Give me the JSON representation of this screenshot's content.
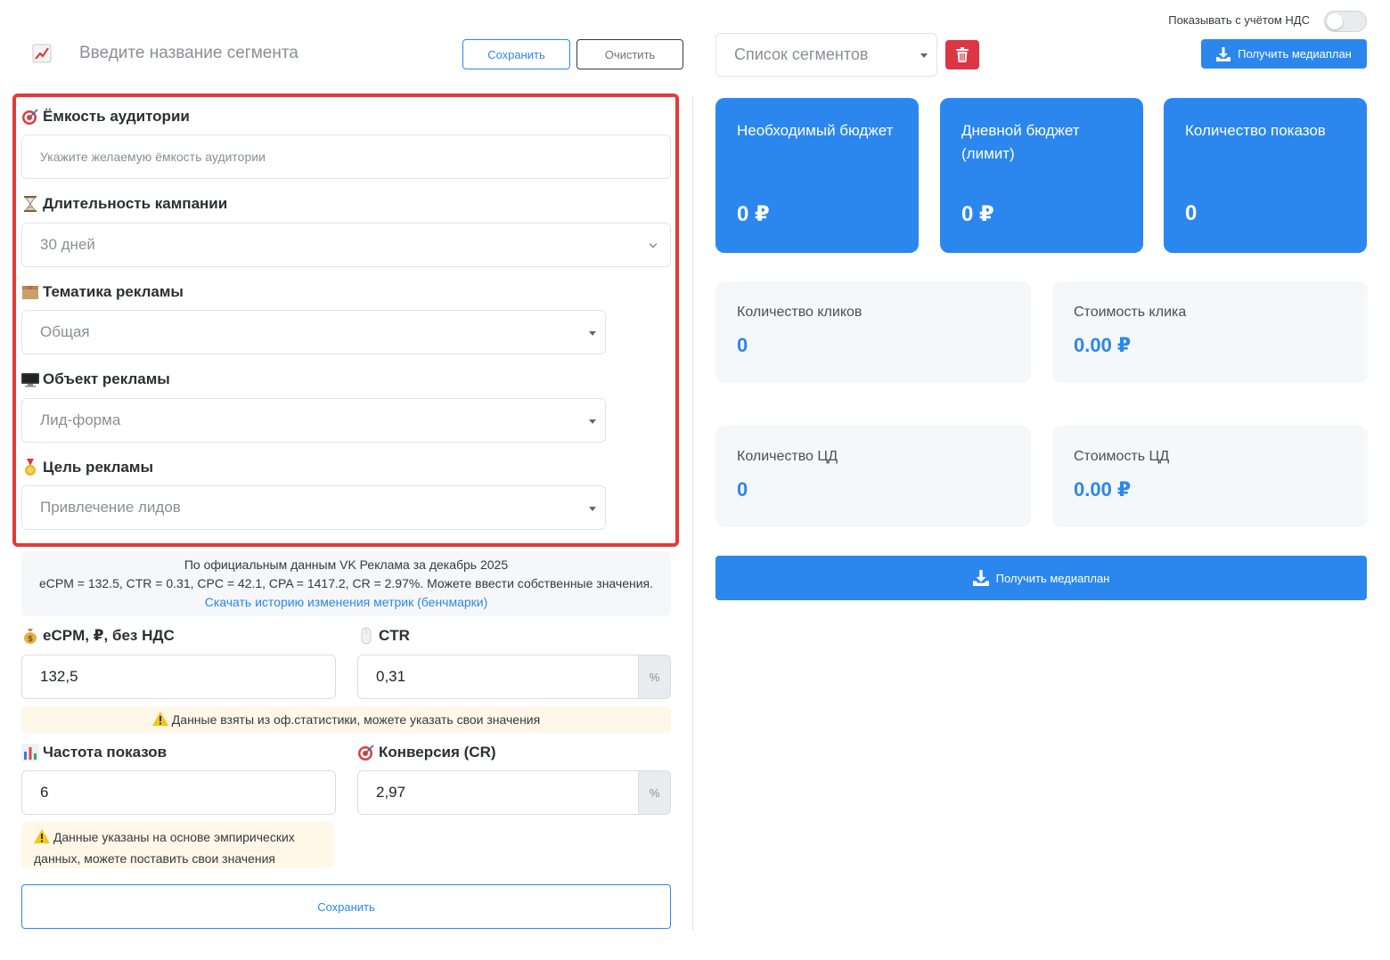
{
  "header": {
    "segment_name_placeholder": "Введите название сегмента",
    "save_label": "Сохранить",
    "clear_label": "Очистить",
    "vat_toggle_label": "Показывать с учётом НДС",
    "vat_toggle_on": false,
    "segments_select_placeholder": "Список сегментов",
    "mediaplan_label": "Получить медиаплан"
  },
  "form": {
    "audience": {
      "label": "Ёмкость аудитории",
      "placeholder": "Укажите желаемую ёмкость аудитории",
      "icon": "target-icon"
    },
    "duration": {
      "label": "Длительность кампании",
      "value": "30 дней",
      "icon": "hourglass-icon"
    },
    "topic": {
      "label": "Тематика рекламы",
      "value": "Общая",
      "icon": "box-icon"
    },
    "object": {
      "label": "Объект рекламы",
      "value": "Лид-форма",
      "icon": "monitor-icon"
    },
    "goal": {
      "label": "Цель рекламы",
      "value": "Привлечение лидов",
      "icon": "medal-icon"
    },
    "info": {
      "line1": "По официальным данным VK Реклама за декабрь 2025",
      "line2": "eCPM = 132.5, CTR = 0.31, CPC = 42.1, CPA = 1417.2, CR = 2.97%. Можете ввести собственные значения.",
      "link": "Скачать историю изменения метрик (бенчмарки)"
    },
    "ecpm": {
      "label": "eCPM, ₽, без НДС",
      "value": "132,5",
      "icon": "money-bag-icon"
    },
    "ctr": {
      "label": "CTR",
      "value": "0,31",
      "addon": "%",
      "icon": "mouse-icon"
    },
    "stats_warning": "Данные взяты из оф.статистики, можете указать свои значения",
    "frequency": {
      "label": "Частота показов",
      "value": "6",
      "icon": "bar-chart-icon"
    },
    "cr": {
      "label": "Конверсия (CR)",
      "value": "2,97",
      "addon": "%",
      "icon": "target-icon"
    },
    "empirical_warning": "Данные указаны на основе эмпирических данных, можете поставить свои значения",
    "save_label": "Сохранить"
  },
  "metrics": {
    "budget": {
      "label": "Необходимый бюджет",
      "value": "0 ₽"
    },
    "daily_budget": {
      "label": "Дневной бюджет (лимит)",
      "value": "0 ₽"
    },
    "impressions": {
      "label": "Количество показов",
      "value": "0"
    },
    "clicks": {
      "label": "Количество кликов",
      "value": "0"
    },
    "click_cost": {
      "label": "Стоимость клика",
      "value": "0.00 ₽"
    },
    "conversions": {
      "label": "Количество ЦД",
      "value": "0"
    },
    "conversion_cost": {
      "label": "Стоимость ЦД",
      "value": "0.00 ₽"
    },
    "mediaplan_label": "Получить медиаплан"
  },
  "colors": {
    "accent": "#2b87ee",
    "danger": "#dc3545",
    "highlight_frame": "#e23a3a",
    "card_grey": "#f6f7f9",
    "warning_bg": "#fff7e8"
  }
}
